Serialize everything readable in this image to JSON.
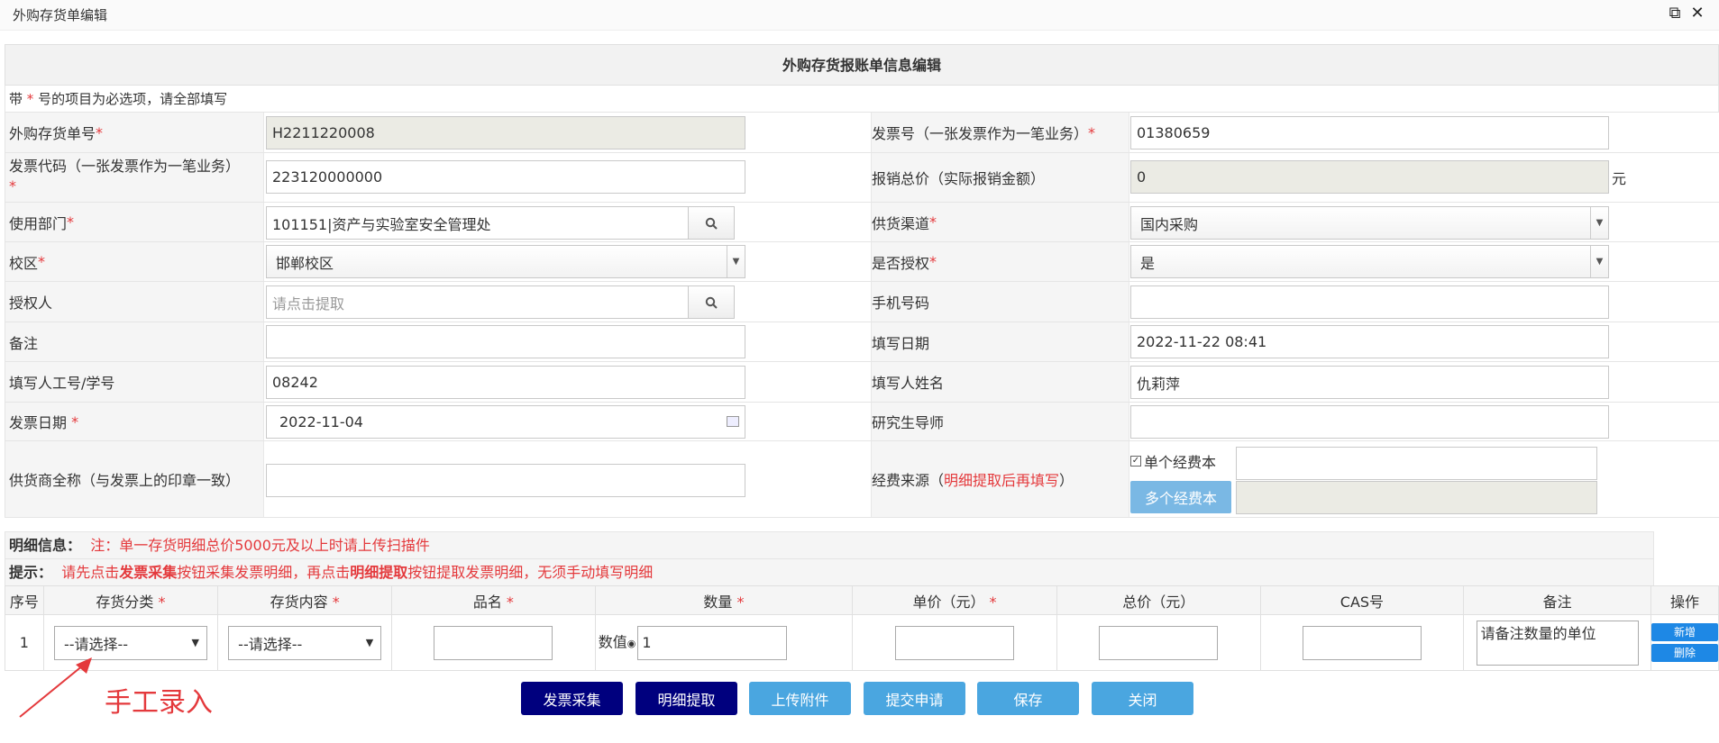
{
  "window": {
    "title": "外购存货单编辑",
    "restore_icon": "window-restore-icon",
    "close_icon": "close-icon"
  },
  "form": {
    "heading": "外购存货报账单信息编辑",
    "required_note": {
      "pre": "带",
      "star": "*",
      "post": "号的项目为必选项，请全部填写"
    },
    "fields": {
      "order_no": {
        "label": "外购存货单号",
        "value": "H2211220008"
      },
      "invoice_no": {
        "label": "发票号（一张发票作为一笔业务）",
        "value": "01380659"
      },
      "invoice_code": {
        "label": "发票代码（一张发票作为一笔业务）",
        "value": "223120000000"
      },
      "total": {
        "label": "报销总价（实际报销金额）",
        "value": "0",
        "unit": "元"
      },
      "dept": {
        "label": "使用部门",
        "value": "101151|资产与实验室安全管理处"
      },
      "channel": {
        "label": "供货渠道",
        "value": "国内采购"
      },
      "campus": {
        "label": "校区",
        "value": "邯郸校区"
      },
      "authorized": {
        "label": "是否授权",
        "value": "是"
      },
      "grantor": {
        "label": "授权人",
        "placeholder": "请点击提取"
      },
      "phone": {
        "label": "手机号码",
        "value": ""
      },
      "remark": {
        "label": "备注",
        "value": ""
      },
      "fill_date": {
        "label": "填写日期",
        "value": "2022-11-22 08:41"
      },
      "filler_id": {
        "label": "填写人工号/学号",
        "value": "08242"
      },
      "filler_name": {
        "label": "填写人姓名",
        "value": "仇莉萍"
      },
      "invoice_date": {
        "label": "发票日期",
        "value": "2022-11-04"
      },
      "advisor": {
        "label": "研究生导师",
        "value": ""
      },
      "supplier": {
        "label": "供货商全称（与发票上的印章一致）",
        "value": ""
      },
      "fund": {
        "label_pre": "经费来源（",
        "label_red": "明细提取后再填写",
        "label_post": "）",
        "single_label": "单个经费本",
        "multi_button": "多个经费本"
      }
    }
  },
  "detail": {
    "info_label": "明细信息：",
    "info_note": "注：单一存货明细总价5000元及以上时请上传扫描件",
    "tip_label": "提示：",
    "tip_parts": [
      "请先点击",
      "发票采集",
      "按钮采集发票明细，再点击",
      "明细提取",
      "按钮提取发票明细，无须手动填写明细"
    ],
    "columns": [
      "序号",
      "存货分类",
      "存货内容",
      "品名",
      "数量",
      "单价（元）",
      "总价（元）",
      "CAS号",
      "备注",
      "操作"
    ],
    "row": {
      "index": "1",
      "category": "--请选择--",
      "content": "--请选择--",
      "qty_label": "数值",
      "qty": "1",
      "remark_placeholder": "请备注数量的单位",
      "add": "新增",
      "delete": "删除"
    }
  },
  "buttons": [
    "发票采集",
    "明细提取",
    "上传附件",
    "提交申请",
    "保存",
    "关闭"
  ],
  "annotation": {
    "text": "手工录入",
    "color": "#e4393c"
  }
}
